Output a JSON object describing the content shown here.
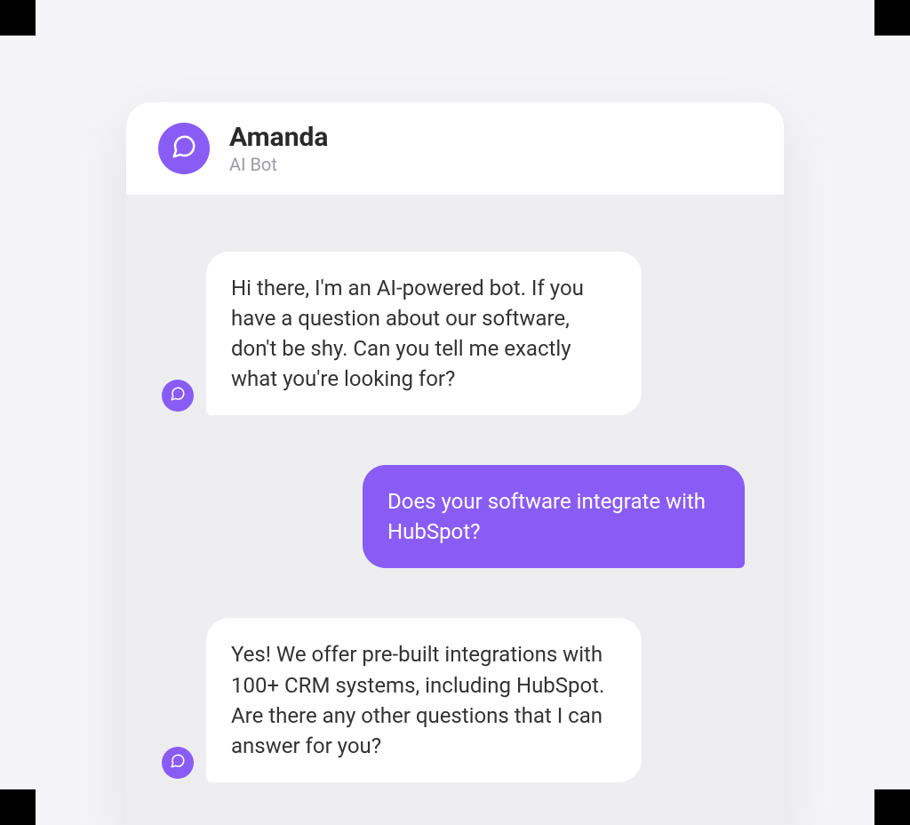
{
  "header": {
    "name": "Amanda",
    "subtitle": "AI Bot"
  },
  "messages": {
    "bot1": "Hi there, I'm an AI-powered bot. If you have a question about our software, don't be shy. Can you tell me exactly what you're looking for?",
    "user1": "Does your software integrate with HubSpot?",
    "bot2": "Yes! We offer pre-built integrations with 100+ CRM systems, including HubSpot. Are there any other questions that I can answer for you?"
  },
  "colors": {
    "accent": "#8a5cf6"
  }
}
